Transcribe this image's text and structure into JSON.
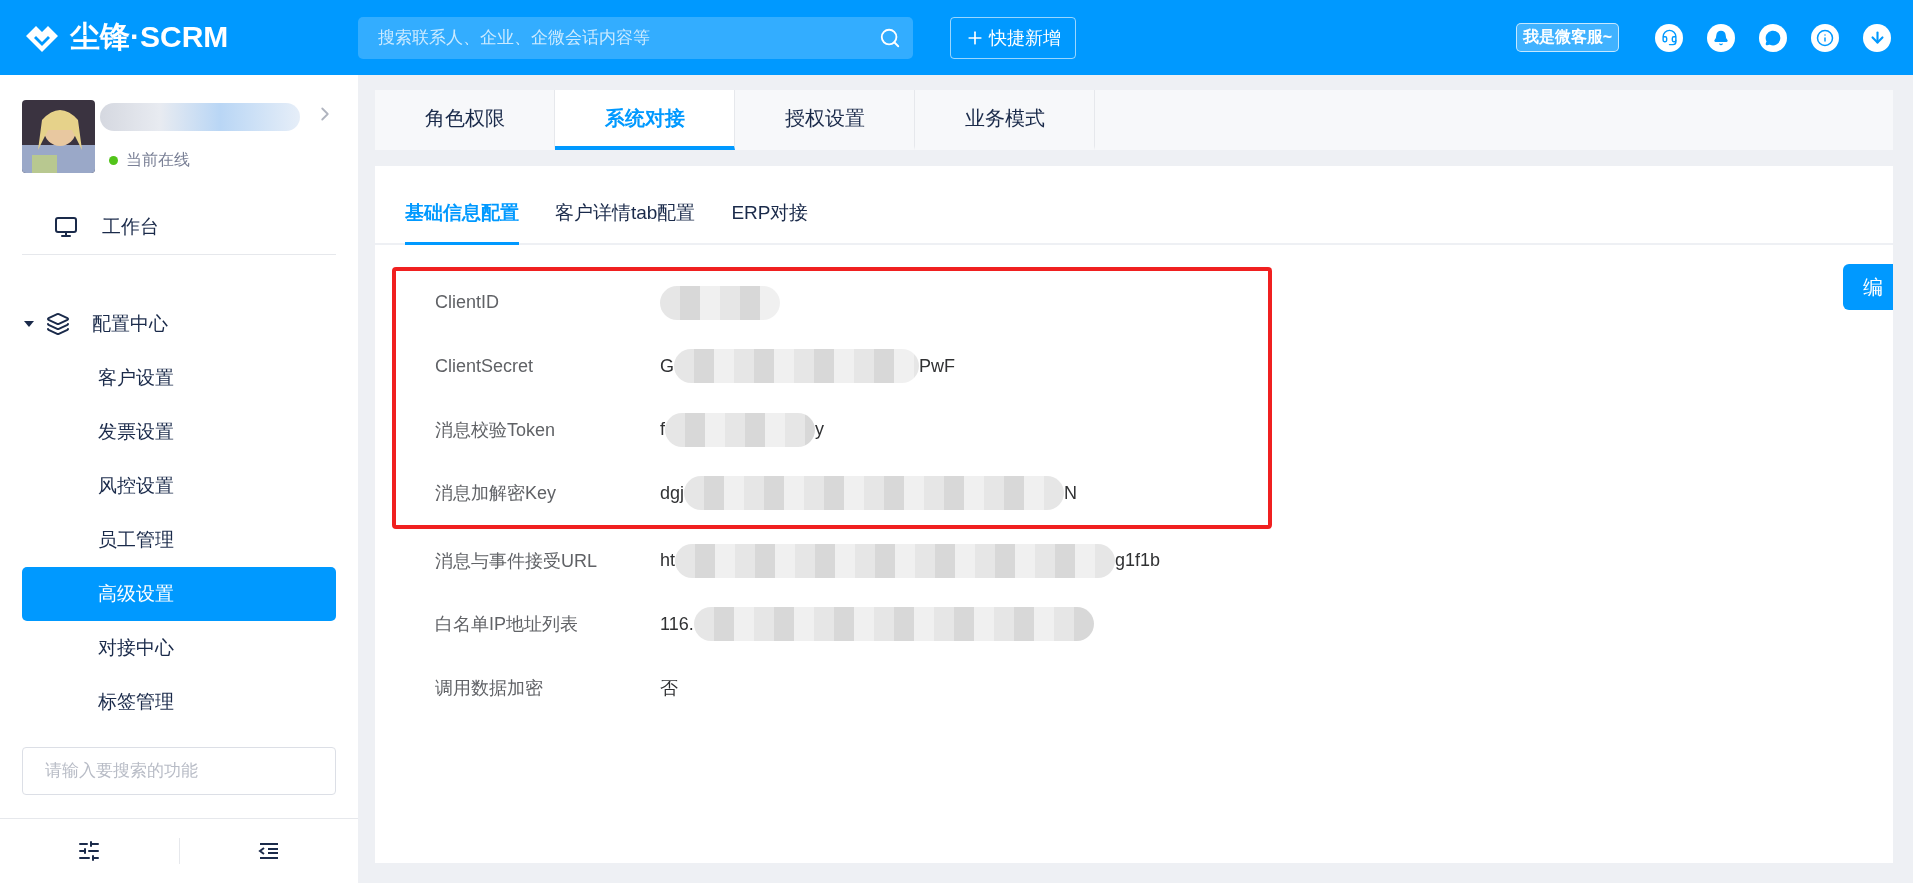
{
  "header": {
    "logo": "尘锋·SCRM",
    "search": {
      "placeholder": "搜索联系人、企业、企微会话内容等"
    },
    "quick_add": "快捷新增",
    "service_badge": "我是微客服~"
  },
  "sidebar": {
    "user": {
      "status": "当前在线",
      "online": true,
      "name_redacted": true
    },
    "nav": [
      {
        "label": "工作台"
      },
      {
        "label": "配置中心",
        "expanded": true,
        "children": [
          {
            "label": "客户设置",
            "selected": false
          },
          {
            "label": "发票设置",
            "selected": false
          },
          {
            "label": "风控设置",
            "selected": false
          },
          {
            "label": "员工管理",
            "selected": false
          },
          {
            "label": "高级设置",
            "selected": true
          },
          {
            "label": "对接中心",
            "selected": false
          },
          {
            "label": "标签管理",
            "selected": false
          }
        ]
      }
    ],
    "search": {
      "placeholder": "请输入要搜索的功能"
    }
  },
  "tabs": [
    {
      "label": "角色权限",
      "selected": false
    },
    {
      "label": "系统对接",
      "selected": true
    },
    {
      "label": "授权设置",
      "selected": false
    },
    {
      "label": "业务模式",
      "selected": false
    }
  ],
  "subtabs": [
    {
      "label": "基础信息配置",
      "selected": true
    },
    {
      "label": "客户详情tab配置",
      "selected": false
    },
    {
      "label": "ERP对接",
      "selected": false
    }
  ],
  "edit_button": "编",
  "fields": [
    {
      "label": "ClientID",
      "redacted": true,
      "highlighted": true
    },
    {
      "label": "ClientSecret",
      "head": "G",
      "tail": "PwF",
      "redacted": true,
      "highlighted": true
    },
    {
      "label": "消息校验Token",
      "head": "f",
      "tail": "y",
      "redacted": true,
      "highlighted": true
    },
    {
      "label": "消息加解密Key",
      "head": "dgj",
      "tail": "N",
      "redacted": true,
      "highlighted": true
    },
    {
      "label": "消息与事件接受URL",
      "head": "ht",
      "tail": "g1f1b",
      "redacted": true,
      "highlighted": false
    },
    {
      "label": "白名单IP地址列表",
      "head": "116.",
      "redacted": true,
      "highlighted": false
    },
    {
      "label": "调用数据加密",
      "head": "否",
      "redacted": false,
      "highlighted": false
    }
  ]
}
